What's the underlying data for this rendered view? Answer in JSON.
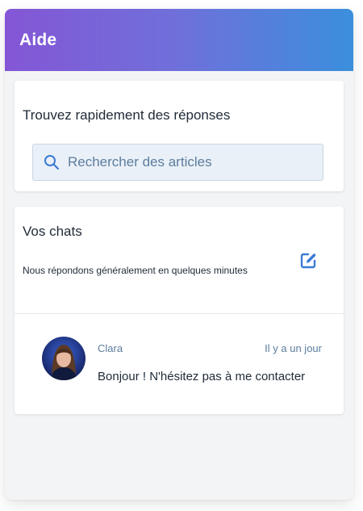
{
  "header": {
    "title": "Aide"
  },
  "search": {
    "heading": "Trouvez rapidement des réponses",
    "placeholder": "Rechercher des articles",
    "value": "",
    "icon": "search-icon"
  },
  "chats": {
    "title": "Vos chats",
    "subtitle": "Nous répondons généralement en quelques minutes",
    "compose_icon": "compose-icon",
    "items": [
      {
        "name": "Clara",
        "time": "Il y a un jour",
        "preview": "Bonjour ! N'hésitez pas à me contacter"
      }
    ]
  },
  "colors": {
    "header_gradient_start": "#8456d6",
    "header_gradient_end": "#3b8fdc",
    "accent": "#3a7bd5",
    "muted_text": "#5c7d9e",
    "body_text": "#1f2a37",
    "search_bg": "#eaf0f7"
  }
}
